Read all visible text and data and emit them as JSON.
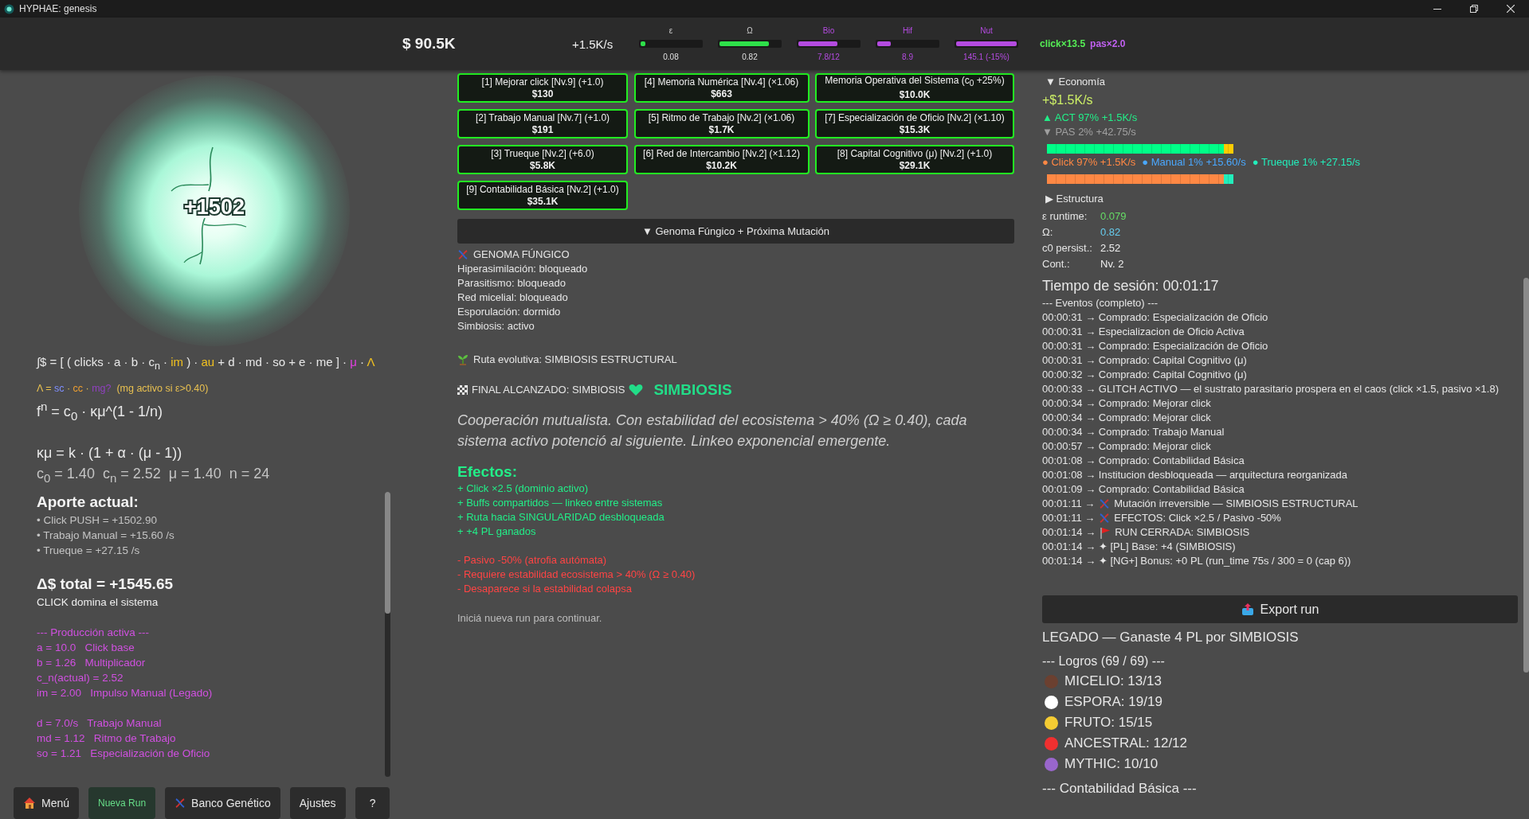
{
  "window": {
    "title": "HYPHAE: genesis"
  },
  "topbar": {
    "money": "$ 90.5K",
    "rate": "+1.5K/s",
    "meters": [
      {
        "label": "ε",
        "reading": "0.08",
        "level": 0.08,
        "color": "#2ee04a"
      },
      {
        "label": "Ω",
        "reading": "0.82",
        "level": 0.82,
        "color": "#2ee04a"
      },
      {
        "label": "Bio",
        "reading": "7.8/12",
        "level": 0.65,
        "color": "#b44be0"
      },
      {
        "label": "Hif",
        "reading": "8.9",
        "level": 0.23,
        "color": "#b44be0"
      },
      {
        "label": "Nut",
        "reading": "145.1 (-15%)",
        "level": 1.0,
        "color": "#b44be0"
      }
    ],
    "multipliers": [
      {
        "text": "click×13.5",
        "color": "#55ee55"
      },
      {
        "text": "pas×2.0",
        "color": "#c060f0"
      }
    ]
  },
  "orb": {
    "popup": "+1502"
  },
  "formula": [
    {
      "kind": "formula",
      "color": "#e8e8e8",
      "segments": [
        {
          "text": "∫$ = [ ( clicks · a · b · c$_{n}$ · "
        },
        {
          "text": "im",
          "color": "#f0c020"
        },
        {
          "text": " ) · "
        },
        {
          "text": "au",
          "color": "#f0c020"
        },
        {
          "text": " + d · md · so + e · me ] · "
        },
        {
          "text": "μ",
          "color": "#e040e0"
        },
        {
          "text": " · "
        },
        {
          "text": "Λ",
          "color": "#f0c020"
        }
      ]
    },
    {
      "kind": "legend",
      "color": "#e8c050",
      "segments": [
        {
          "text": "Λ = "
        },
        {
          "text": "sc",
          "color": "#7f8fff"
        },
        {
          "text": " · "
        },
        {
          "text": "cc",
          "color": "#f0a030"
        },
        {
          "text": " · "
        },
        {
          "text": "mg?",
          "color": "#9040c0"
        },
        {
          "text": "  (mg activo si ε>0.40)"
        }
      ]
    },
    {
      "kind": "equation",
      "color": "#e8e8e8",
      "segments": [
        {
          "text": "f$^{n}$ = c$_{0}$ · κμ^(1 - 1/n)"
        }
      ]
    },
    {
      "kind": "derived",
      "color": "#e8e8e8",
      "segments": [
        {
          "text": "κμ = k · (1 + α · (μ - 1))"
        }
      ]
    },
    {
      "kind": "values",
      "color": "#c4c4c4",
      "segments": [
        {
          "text": "c$_{0}$ = 1.40  c$_{n}$ = 2.52  μ = 1.40  n = 24"
        }
      ]
    }
  ],
  "contribution": {
    "title": "Aporte actual:",
    "items": [
      "• Click PUSH = +1502.90",
      "• Trabajo Manual = +15.60 /s",
      "• Trueque = +27.15 /s"
    ]
  },
  "total": {
    "value": "Δ$ total = +1545.65",
    "note": "CLICK domina el sistema"
  },
  "production": {
    "title": "--- Producción activa ---",
    "groups": [
      [
        "a = 10.0   Click base",
        "b = 1.26   Multiplicador",
        "c_n(actual) = 2.52",
        "im = 2.00   Impulso Manual (Legado)"
      ],
      [
        "d = 7.0/s   Trabajo Manual",
        "md = 1.12   Ritmo de Trabajo",
        "so = 1.21   Especialización de Oficio"
      ]
    ]
  },
  "bottom_buttons": [
    {
      "label": "Menú",
      "kind": "home"
    },
    {
      "label": "Nueva Run",
      "kind": "primary"
    },
    {
      "label": "Banco Genético",
      "kind": "genetic"
    },
    {
      "label": "Ajustes",
      "kind": "plain"
    },
    {
      "label": "?",
      "kind": "plain"
    }
  ],
  "upgrades": [
    {
      "label": "[1] Mejorar click [Nv.9] (+1.0)",
      "cost": "$130"
    },
    {
      "label": "[4] Memoria Numérica [Nv.4] (×1.06)",
      "cost": "$663"
    },
    {
      "label": "Memoria Operativa del Sistema (c$_{0}$ +25%)",
      "cost": "$10.0K"
    },
    {
      "label": "[2] Trabajo Manual [Nv.7] (+1.0)",
      "cost": "$191"
    },
    {
      "label": "[5] Ritmo de Trabajo [Nv.2] (×1.06)",
      "cost": "$1.7K"
    },
    {
      "label": "[7] Especialización de Oficio [Nv.2] (×1.10)",
      "cost": "$15.3K"
    },
    {
      "label": "[3] Trueque [Nv.2] (+6.0)",
      "cost": "$5.8K"
    },
    {
      "label": "[6] Red de Intercambio [Nv.2] (×1.12)",
      "cost": "$10.2K"
    },
    {
      "label": "[8] Capital Cognitivo (μ) [Nv.2] (+1.0)",
      "cost": "$29.1K"
    },
    {
      "label": "[9] Contabilidad Básica [Nv.2] (+1.0)",
      "cost": "$35.1K"
    }
  ],
  "genome_toggle": "▼ Genoma Fúngico + Próxima Mutación",
  "genome": {
    "title": "GENOMA FÚNGICO",
    "traits": [
      "Hiperasimilación: bloqueado",
      "Parasitismo: bloqueado",
      "Red micelial: bloqueado",
      "Esporulación: dormido",
      "Simbiosis: activo"
    ],
    "route": "Ruta evolutiva: SIMBIOSIS ESTRUCTURAL",
    "final_label": "FINAL ALCANZADO: SIMBIOSIS",
    "final_badge": "SIMBIOSIS",
    "description": "Cooperación mutualista. Con estabilidad del ecosistema > 40% (Ω ≥ 0.40), cada sistema activo potenció al siguiente. Linkeo exponencial emergente.",
    "effects_title": "Efectos:",
    "effects": [
      "+ Click ×2.5 (dominio activo)",
      "+ Buffs compartidos — linkeo entre sistemas",
      "+ Ruta hacia SINGULARIDAD desbloqueada",
      "+ +4 PL ganados"
    ],
    "penalties": [
      "- Pasivo -50% (atrofia autómata)",
      "- Requiere estabilidad ecosistema > 40% (Ω ≥ 0.40)",
      "- Desaparece si la estabilidad colapsa"
    ],
    "hint": "Iniciá nueva run para continuar."
  },
  "economy": {
    "header": "▼ Economía",
    "total": "+$1.5K/s",
    "act": "▲ ACT  97%  +1.5K/s",
    "pas": "▼ PAS  2%  +42.75/s",
    "mix_bar": [
      {
        "level": 0.95,
        "color": "#00ff88"
      },
      {
        "level": 0.05,
        "color": "#ffcc00"
      }
    ],
    "sources": [
      {
        "text": "● Click 97% +1.5K/s",
        "color": "#ff8844"
      },
      {
        "text": "● Manual 1% +15.60/s",
        "color": "#4aa8ff"
      },
      {
        "text": "● Trueque 1% +27.15/s",
        "color": "#22eebb"
      }
    ],
    "source_bar": [
      {
        "level": 0.95,
        "color": "#ff8844"
      },
      {
        "level": 0.05,
        "color": "#22eebb"
      }
    ]
  },
  "structure": {
    "header": "▶ Estructura",
    "stats": [
      {
        "label": "ε runtime:",
        "value": "0.079",
        "color": "#66dd66"
      },
      {
        "label": "Ω:",
        "value": "0.82",
        "color": "#66ccee"
      },
      {
        "label": "c0 persist.:",
        "value": "2.52",
        "color": "#eeeeee"
      },
      {
        "label": "Cont.:",
        "value": "Nv. 2",
        "color": "#eeeeee"
      }
    ]
  },
  "session_time": "Tiempo de sesión: 00:01:17",
  "events": {
    "title": "--- Eventos (completo) ---",
    "items": [
      {
        "kind": "plain",
        "text": "00:00:31 → Comprado: Especialización de Oficio"
      },
      {
        "kind": "plain",
        "text": "00:00:31 → Especializacion de Oficio Activa"
      },
      {
        "kind": "plain",
        "text": "00:00:31 → Comprado: Especialización de Oficio"
      },
      {
        "kind": "plain",
        "text": "00:00:31 → Comprado: Capital Cognitivo (μ)"
      },
      {
        "kind": "plain",
        "text": "00:00:32 → Comprado: Capital Cognitivo (μ)"
      },
      {
        "kind": "plain",
        "text": "00:00:33 → GLITCH ACTIVO — el sustrato parasitario prospera en el caos (click ×1.5, pasivo ×1.8)"
      },
      {
        "kind": "plain",
        "text": "00:00:34 → Comprado: Mejorar click"
      },
      {
        "kind": "plain",
        "text": "00:00:34 → Comprado: Mejorar click"
      },
      {
        "kind": "plain",
        "text": "00:00:34 → Comprado: Trabajo Manual"
      },
      {
        "kind": "plain",
        "text": "00:00:57 → Comprado: Mejorar click"
      },
      {
        "kind": "plain",
        "text": "00:01:08 → Comprado: Contabilidad Básica"
      },
      {
        "kind": "plain",
        "text": "00:01:08 → Institucion desbloqueada — arquitectura reorganizada"
      },
      {
        "kind": "plain",
        "text": "00:01:09 → Comprado: Contabilidad Básica"
      },
      {
        "kind": "mutation",
        "prefix": "00:01:11 →",
        "text": "Mutación irreversible — SIMBIOSIS ESTRUCTURAL"
      },
      {
        "kind": "mutation",
        "prefix": "00:01:11 →",
        "text": "EFECTOS: Click ×2.5 / Pasivo -50%"
      },
      {
        "kind": "flag",
        "prefix": "00:01:14 →",
        "text": "RUN CERRADA: SIMBIOSIS"
      },
      {
        "kind": "plain",
        "text": "00:01:14 → ✦ [PL] Base: +4 (SIMBIOSIS)"
      },
      {
        "kind": "plain",
        "text": "00:01:14 → ✦ [NG+] Bonus: +0 PL (run_time 75s / 300 = 0 (cap 6))"
      }
    ]
  },
  "export_button": "Export run",
  "legacy": "LEGADO — Ganaste 4 PL por SIMBIOSIS",
  "achievements": {
    "title": "--- Logros (69 / 69) ---",
    "items": [
      {
        "label": "MICELIO: 13/13",
        "color": "#6b4030"
      },
      {
        "label": "ESPORA: 19/19",
        "color": "#ffffff"
      },
      {
        "label": "FRUTO: 15/15",
        "color": "#f5cc33"
      },
      {
        "label": "ANCESTRAL: 12/12",
        "color": "#f03030"
      },
      {
        "label": "MYTHIC: 10/10",
        "color": "#9966cc"
      }
    ]
  },
  "next_section": "--- Contabilidad Básica ---"
}
